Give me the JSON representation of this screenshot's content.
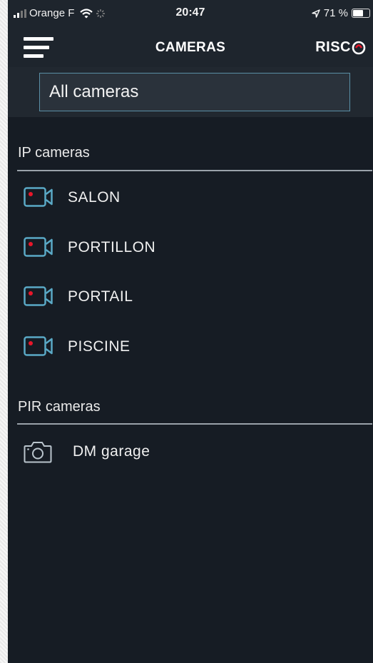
{
  "status_bar": {
    "carrier": "Orange F",
    "time": "20:47",
    "battery_percent": "71 %",
    "battery_level": 0.71
  },
  "header": {
    "title": "CAMERAS",
    "logo_text": "RISC"
  },
  "filter": {
    "selected": "All cameras"
  },
  "sections": {
    "ip": {
      "title": "IP cameras",
      "items": [
        "SALON",
        "PORTILLON",
        "PORTAIL",
        "PISCINE"
      ]
    },
    "pir": {
      "title": "PIR cameras",
      "items": [
        "DM garage"
      ]
    }
  },
  "colors": {
    "background": "#161c24",
    "header": "#1e252d",
    "accent": "#5aa9c6",
    "record_dot": "#e8162a",
    "divider": "#9aa2aa"
  },
  "icons": {
    "ip_camera": "video-camera-icon",
    "pir_camera": "photo-camera-icon",
    "menu": "hamburger-icon"
  }
}
